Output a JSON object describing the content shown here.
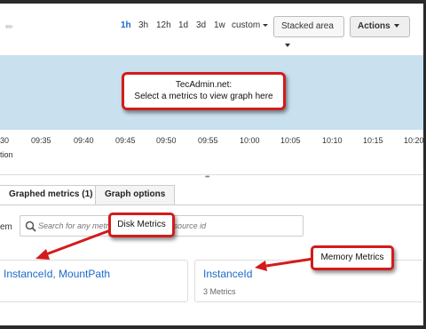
{
  "toolbar": {
    "time_ranges": [
      "1h",
      "3h",
      "12h",
      "1d",
      "3d",
      "1w",
      "custom"
    ],
    "active_range": "1h",
    "graph_type": "Stacked area",
    "actions_label": "Actions"
  },
  "graph": {
    "annotation_line1": "TecAdmin.net:",
    "annotation_line2": "Select a metrics to view graph here",
    "time_ticks": [
      "30",
      "09:35",
      "09:40",
      "09:45",
      "09:50",
      "09:55",
      "10:00",
      "10:05",
      "10:10",
      "10:15",
      "10:20"
    ],
    "footer_label": "tion"
  },
  "tabs": {
    "graphed_metrics": "Graphed metrics (1)",
    "graph_options": "Graph options"
  },
  "search": {
    "label": "em",
    "placeholder": "Search for any metric, dimension or resource id"
  },
  "cards": [
    {
      "title": "InstanceId, MountPath",
      "subtitle": ""
    },
    {
      "title": "InstanceId",
      "subtitle": "3 Metrics"
    }
  ],
  "callouts": {
    "disk": "Disk Metrics",
    "memory": "Memory Metrics"
  },
  "colors": {
    "accent": "#1b6ac9",
    "callout_border": "#d41b1b",
    "graph_bg": "#c9e0ee"
  }
}
